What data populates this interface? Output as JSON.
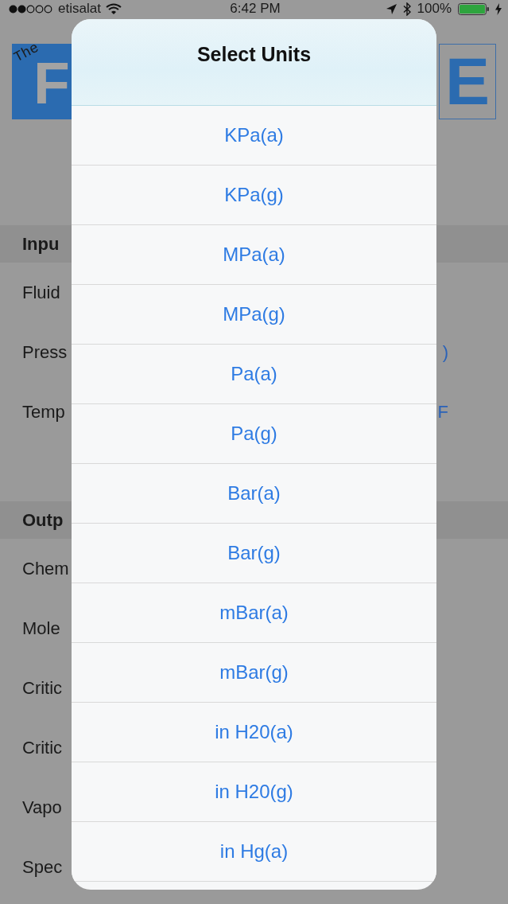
{
  "status_bar": {
    "carrier": "etisalat",
    "time": "6:42 PM",
    "battery": "100%"
  },
  "logo": {
    "small_text": "The",
    "left_letter": "F",
    "right_letter": "E"
  },
  "sections": [
    {
      "title": "Inpu",
      "rows": [
        {
          "label": "Fluid"
        },
        {
          "label": "Press",
          "value": ")"
        },
        {
          "label": "Temp",
          "value": "F"
        }
      ]
    },
    {
      "title": "Outp",
      "rows": [
        {
          "label": "Chem"
        },
        {
          "label": "Mole"
        },
        {
          "label": "Critic"
        },
        {
          "label": "Critic"
        },
        {
          "label": "Vapo"
        },
        {
          "label": "Spec"
        }
      ]
    }
  ],
  "dialog": {
    "title": "Select Units",
    "options": [
      "KPa(a)",
      "KPa(g)",
      "MPa(a)",
      "MPa(g)",
      "Pa(a)",
      "Pa(g)",
      "Bar(a)",
      "Bar(g)",
      "mBar(a)",
      "mBar(g)",
      "in H20(a)",
      "in H20(g)",
      "in Hg(a)"
    ]
  }
}
